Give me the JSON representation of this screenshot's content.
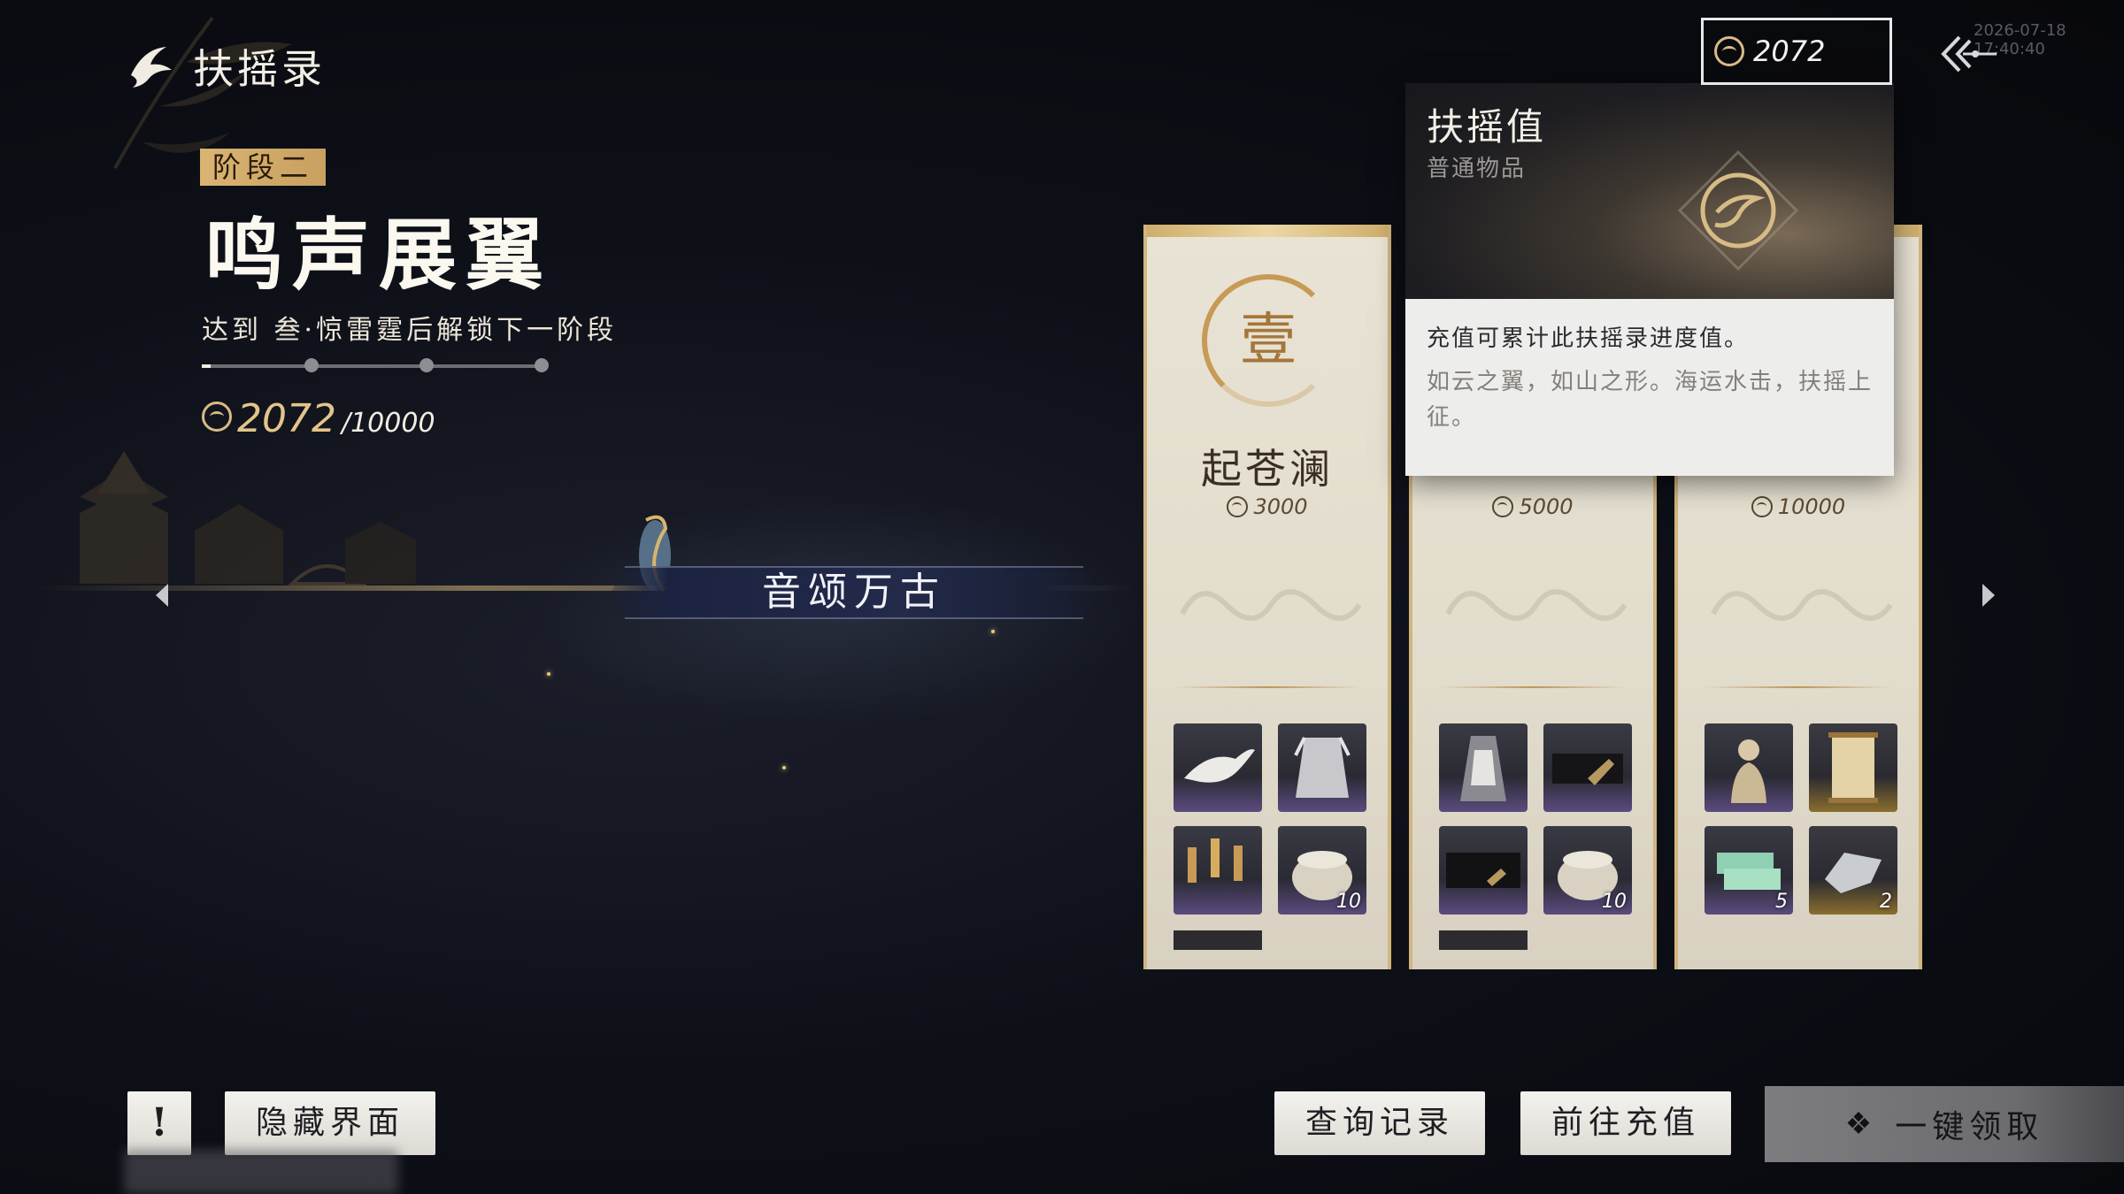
{
  "header": {
    "title": "扶摇录",
    "currency_value": "2072",
    "timestamp": "2026-07-18 17:40:40"
  },
  "stage": {
    "badge": "阶段二",
    "title": "鸣声展翼",
    "description": "达到 叁·惊雷霆后解锁下一阶段",
    "progress_current": "2072",
    "progress_max": "/10000",
    "progress_fraction": 0.2072
  },
  "banner": {
    "label": "音颂万古"
  },
  "cards": [
    {
      "numeral": "壹",
      "name": "起苍澜",
      "cost": "3000",
      "items": [
        {
          "icon": "white-dove-icon",
          "count": ""
        },
        {
          "icon": "silver-garment-icon",
          "count": ""
        },
        {
          "icon": "golden-lanterns-icon",
          "count": ""
        },
        {
          "icon": "ceramic-jar-icon",
          "count": "10"
        }
      ]
    },
    {
      "numeral": "",
      "name": "",
      "cost": "5000",
      "items": [
        {
          "icon": "robe-costume-icon",
          "count": ""
        },
        {
          "icon": "dark-blade-icon",
          "count": ""
        },
        {
          "icon": "dark-scroll-icon",
          "count": ""
        },
        {
          "icon": "ceramic-jar-icon",
          "count": "10"
        }
      ]
    },
    {
      "numeral": "",
      "name": "",
      "cost": "10000",
      "items": [
        {
          "icon": "figure-statue-icon",
          "count": ""
        },
        {
          "icon": "golden-scroll-icon",
          "count": ""
        },
        {
          "icon": "cash-stack-icon",
          "count": "5"
        },
        {
          "icon": "crystal-shard-icon",
          "count": "2"
        }
      ]
    }
  ],
  "tooltip": {
    "title": "扶摇值",
    "subtitle": "普通物品",
    "line1": "充值可累计此扶摇录进度值。",
    "line2": "如云之翼，如山之形。海运水击，扶摇上征。"
  },
  "buttons": {
    "warn": "!",
    "hide": "隐藏界面",
    "records": "查询记录",
    "recharge": "前往充值",
    "claim": "一键领取"
  },
  "colors": {
    "gold_accent": "#d9b472",
    "card_bg": "#e9e3d5",
    "button_bg": "#f4f2ee"
  }
}
